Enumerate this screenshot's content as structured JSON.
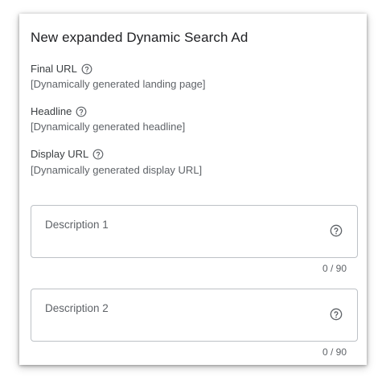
{
  "ad": {
    "title": "New expanded Dynamic Search Ad",
    "fields": [
      {
        "label": "Final URL",
        "value": "[Dynamically generated landing page]"
      },
      {
        "label": "Headline",
        "value": "[Dynamically generated headline]"
      },
      {
        "label": "Display URL",
        "value": "[Dynamically generated display URL]"
      }
    ],
    "descriptions": [
      {
        "placeholder": "Description 1",
        "counter": "0 / 90"
      },
      {
        "placeholder": "Description 2",
        "counter": "0 / 90"
      }
    ]
  },
  "icons": {
    "help": "help-circle-icon"
  }
}
